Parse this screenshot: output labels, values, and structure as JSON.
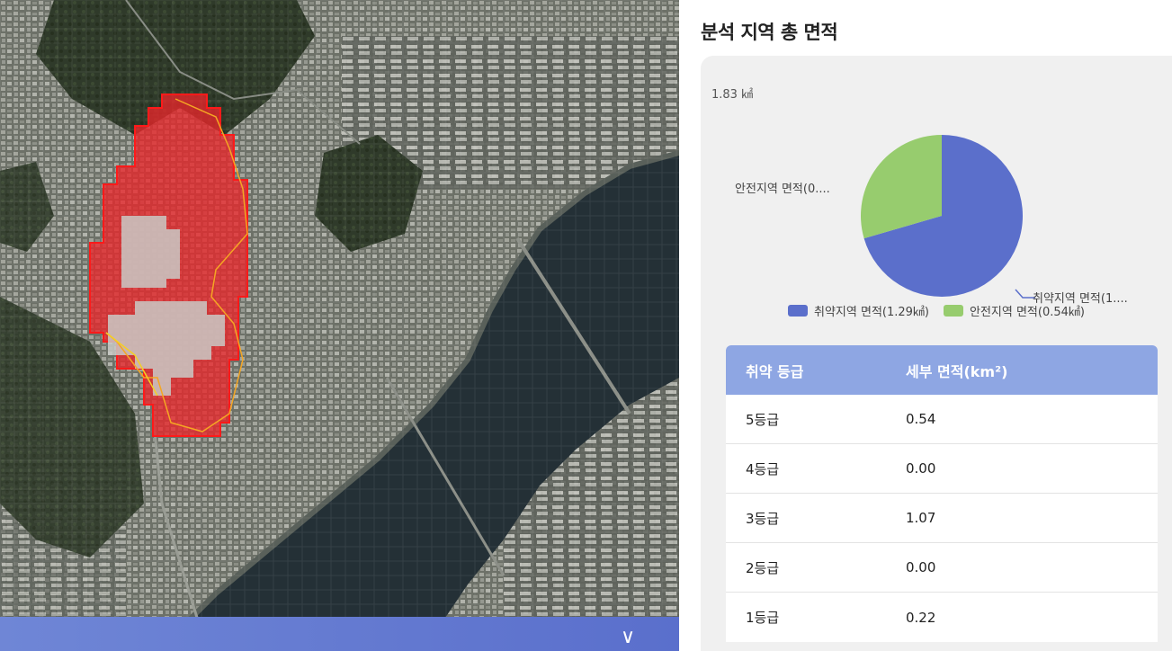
{
  "panel": {
    "title": "분석 지역 총 면적",
    "total_area": "1.83 ㎢"
  },
  "colors": {
    "vulnerable": "#5b6fcb",
    "safe": "#97cc6e",
    "table_header": "#8ea6e3",
    "overlay_red": "#e8262a",
    "footer_bar": "#6077d0"
  },
  "chart_data": {
    "type": "pie",
    "slices": [
      {
        "label": "취약지역 면적(1.29㎢)",
        "callout": "취약지역 면적(1....",
        "value": 1.29
      },
      {
        "label": "안전지역 면적(0.54㎢)",
        "callout": "안전지역 면적(0....",
        "value": 0.54
      }
    ],
    "legend_placement": "bottom"
  },
  "table": {
    "headers": [
      "취약 등급",
      "세부 면적(km²)"
    ],
    "rows": [
      [
        "5등급",
        "0.54"
      ],
      [
        "4등급",
        "0.00"
      ],
      [
        "3등급",
        "1.07"
      ],
      [
        "2등급",
        "0.00"
      ],
      [
        "1등급",
        "0.22"
      ]
    ]
  },
  "map": {
    "collapse_icon": "chevron-down-icon",
    "collapse_glyph": "∨"
  }
}
